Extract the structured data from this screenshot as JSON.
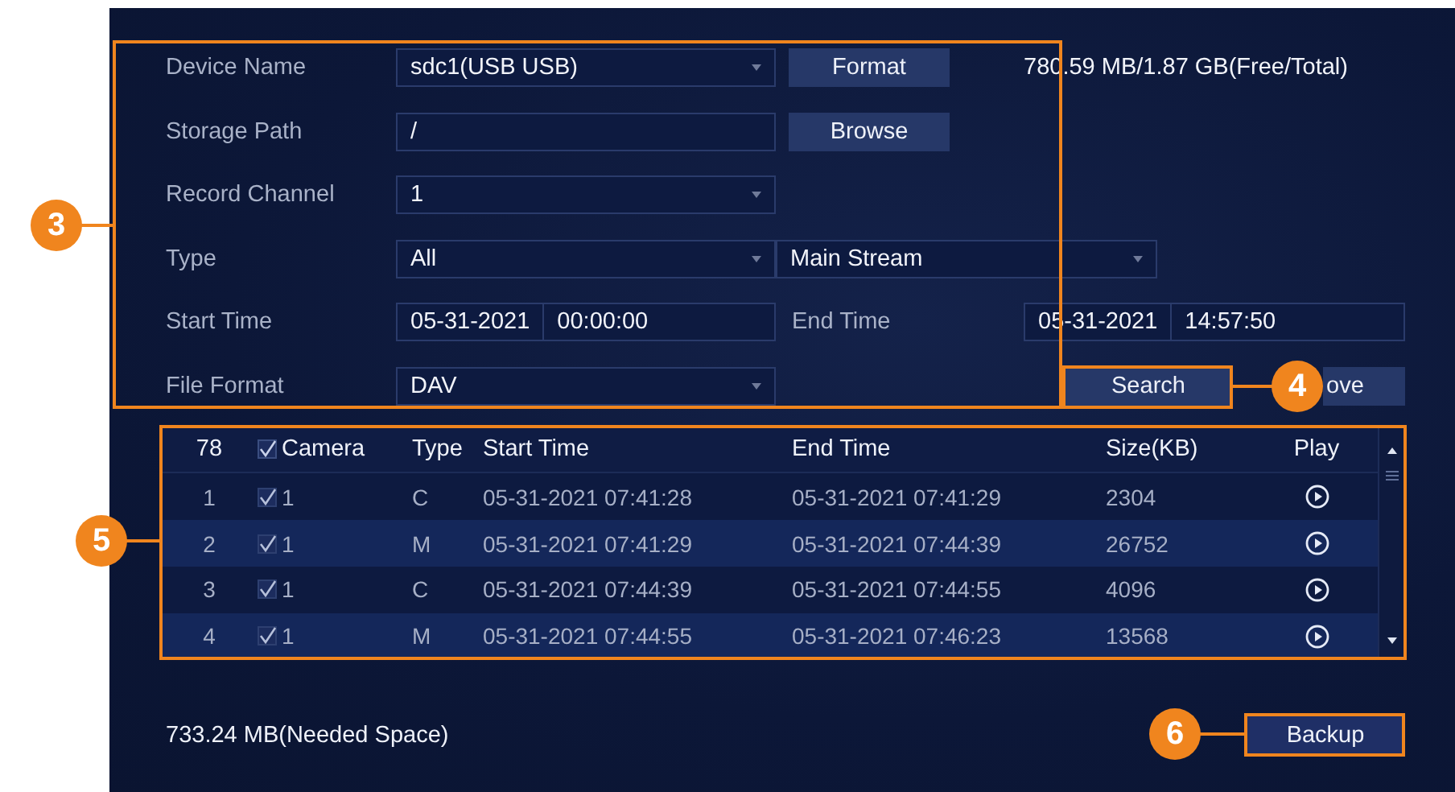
{
  "form": {
    "device_name": {
      "label": "Device Name",
      "value": "sdc1(USB USB)"
    },
    "format_button": "Format",
    "capacity": "780.59 MB/1.87 GB(Free/Total)",
    "storage_path": {
      "label": "Storage Path",
      "value": "/"
    },
    "browse_button": "Browse",
    "record_channel": {
      "label": "Record Channel",
      "value": "1"
    },
    "type": {
      "label": "Type",
      "value": "All"
    },
    "stream": {
      "value": "Main Stream"
    },
    "start_time": {
      "label": "Start Time",
      "date": "05-31-2021",
      "time": "00:00:00"
    },
    "end_time": {
      "label": "End Time",
      "date": "05-31-2021",
      "time": "14:57:50"
    },
    "file_format": {
      "label": "File Format",
      "value": "DAV"
    },
    "search_button": "Search",
    "remove_button": "ove"
  },
  "table": {
    "count": "78",
    "all_checked": true,
    "columns": [
      "Camera",
      "Type",
      "Start Time",
      "End Time",
      "Size(KB)",
      "Play"
    ],
    "rows": [
      {
        "index": "1",
        "checked": true,
        "camera": "1",
        "type": "C",
        "start": "05-31-2021 07:41:28",
        "end": "05-31-2021 07:41:29",
        "size": "2304"
      },
      {
        "index": "2",
        "checked": true,
        "camera": "1",
        "type": "M",
        "start": "05-31-2021 07:41:29",
        "end": "05-31-2021 07:44:39",
        "size": "26752"
      },
      {
        "index": "3",
        "checked": true,
        "camera": "1",
        "type": "C",
        "start": "05-31-2021 07:44:39",
        "end": "05-31-2021 07:44:55",
        "size": "4096"
      },
      {
        "index": "4",
        "checked": true,
        "camera": "1",
        "type": "M",
        "start": "05-31-2021 07:44:55",
        "end": "05-31-2021 07:46:23",
        "size": "13568"
      }
    ]
  },
  "needed_space": "733.24 MB(Needed Space)",
  "backup_button": "Backup",
  "callouts": [
    {
      "number": "3"
    },
    {
      "number": "4"
    },
    {
      "number": "5"
    },
    {
      "number": "6"
    }
  ]
}
